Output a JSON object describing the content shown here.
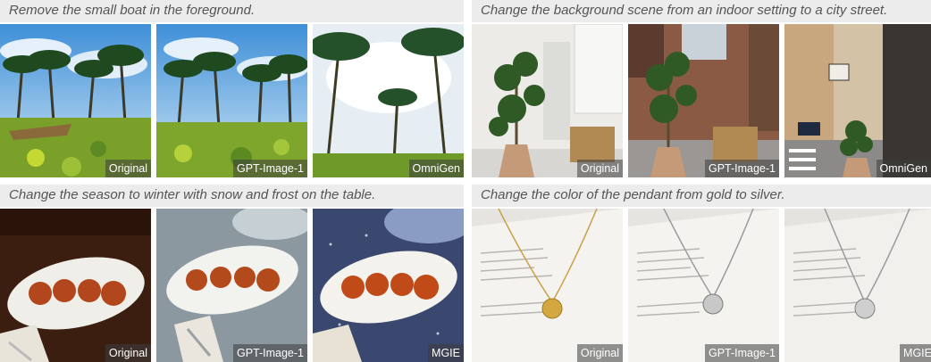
{
  "panels": [
    {
      "caption": "Remove the small boat in the foreground.",
      "labels": [
        "Original",
        "GPT-Image-1",
        "OmniGen"
      ]
    },
    {
      "caption": "Change the background scene from an indoor setting to a city street.",
      "labels": [
        "Original",
        "GPT-Image-1",
        "OmniGen"
      ]
    },
    {
      "caption": "Change the season to winter with snow and frost on the table.",
      "labels": [
        "Original",
        "GPT-Image-1",
        "MGIE"
      ]
    },
    {
      "caption": "Change the color of the pendant from gold to silver.",
      "labels": [
        "Original",
        "GPT-Image-1",
        "MGIE"
      ]
    }
  ]
}
